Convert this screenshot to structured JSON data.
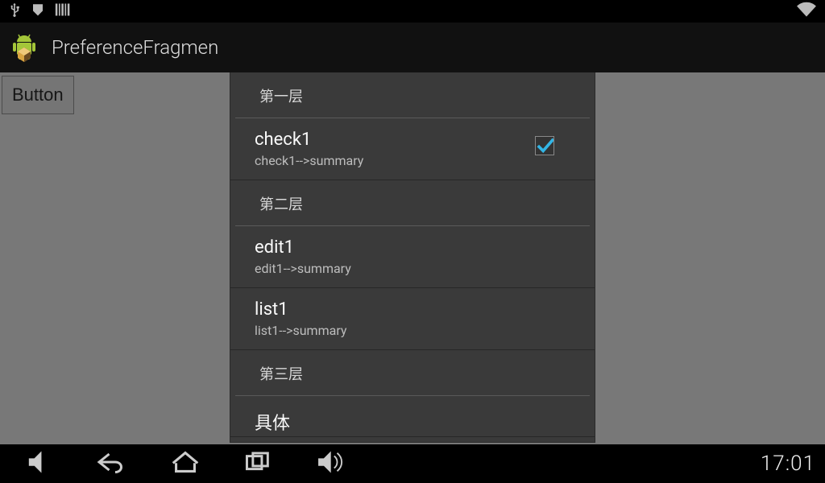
{
  "statusbar": {
    "icons": [
      "usb-icon",
      "download-icon",
      "barcode-icon"
    ],
    "right_icon": "wifi-icon"
  },
  "actionbar": {
    "title": "PreferenceFragmen"
  },
  "background": {
    "button_label": "Button"
  },
  "dialog": {
    "categories": [
      {
        "header": "第一层",
        "items": [
          {
            "title": "check1",
            "summary": "check1-->summary",
            "type": "checkbox",
            "checked": true
          }
        ]
      },
      {
        "header": "第二层",
        "items": [
          {
            "title": "edit1",
            "summary": "edit1-->summary",
            "type": "edit"
          },
          {
            "title": "list1",
            "summary": "list1-->summary",
            "type": "list"
          }
        ]
      },
      {
        "header": "第三层",
        "items": [
          {
            "title": "具体",
            "summary": "",
            "type": "screen"
          }
        ]
      }
    ]
  },
  "navbar": {
    "clock": "17:01"
  },
  "colors": {
    "accent": "#33b5e5",
    "dialog_bg": "#3a3a3a"
  }
}
